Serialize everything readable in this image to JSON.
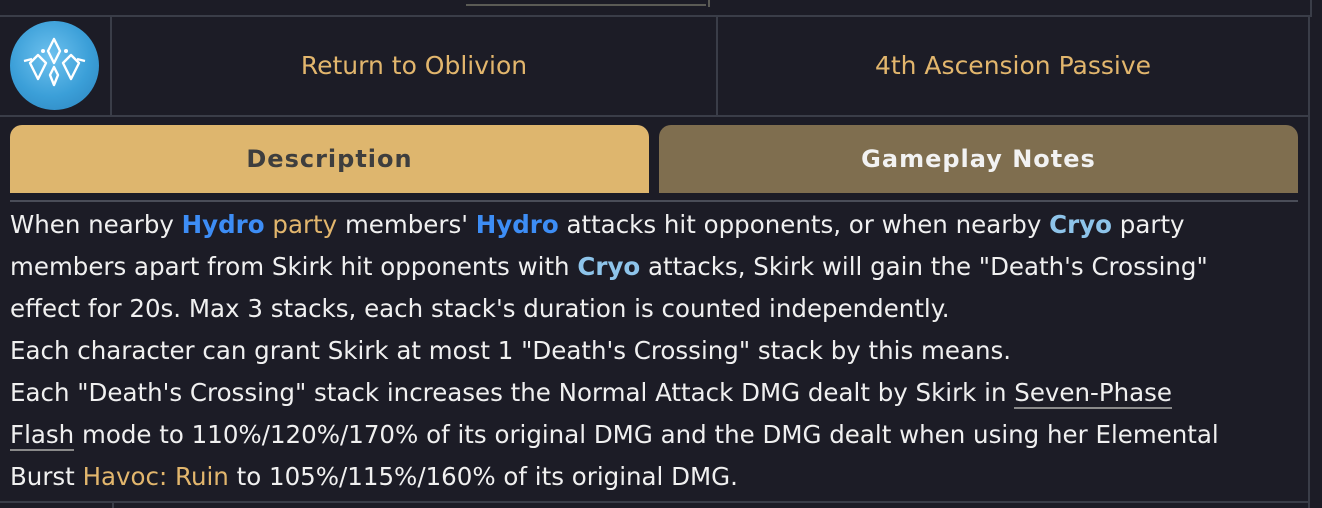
{
  "ability": {
    "icon": "skill-crystal-icon",
    "name": "Return to Oblivion",
    "type": "4th Ascension Passive"
  },
  "tabs": {
    "description": "Description",
    "gameplay_notes": "Gameplay Notes",
    "active": "Description"
  },
  "colors": {
    "hydro": "#3d8df5",
    "cryo": "#8ec4ea",
    "gold_accent": "#e2b66d",
    "active_tab": "#deb66e",
    "inactive_tab": "#7f6e4f",
    "background": "#1c1c26"
  },
  "description": {
    "l1": {
      "a": "When nearby ",
      "hydro1": "Hydro",
      "b": " ",
      "party": "party",
      "c": " members' ",
      "hydro2": "Hydro",
      "d": " attacks hit opponents, or when nearby ",
      "cryo1": "Cryo",
      "e": " party"
    },
    "l2": {
      "a": "members apart from Skirk hit opponents with ",
      "cryo2": "Cryo",
      "b": " attacks, Skirk will gain the \"Death's Crossing\""
    },
    "l3": "effect for 20s. Max 3 stacks, each stack's duration is counted independently.",
    "l4": "Each character can grant Skirk at most 1 \"Death's Crossing\" stack by this means.",
    "l5": {
      "a": "Each \"Death's Crossing\" stack increases the Normal Attack DMG dealt by Skirk in ",
      "link1": "Seven-Phase"
    },
    "l6": {
      "link2": "Flash",
      "b": " mode to 110%/120%/170% of its original DMG and the DMG dealt when using her Elemental"
    },
    "l7": {
      "a": "Burst ",
      "burst": "Havoc: Ruin",
      "b": " to 105%/115%/160% of its original DMG."
    }
  }
}
